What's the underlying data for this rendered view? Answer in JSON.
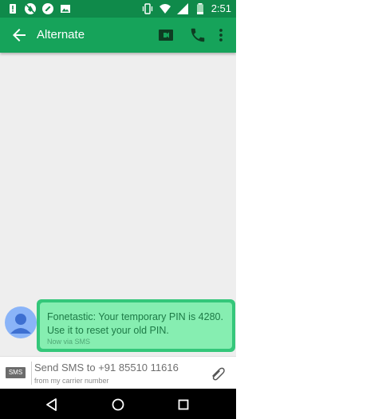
{
  "status_bar": {
    "time": "2:51",
    "left_icons": [
      "alert-icon",
      "no-disturb-icon",
      "edit-icon",
      "image-icon"
    ],
    "right_icons": [
      "vibrate-icon",
      "wifi-icon",
      "signal-icon",
      "battery-icon"
    ]
  },
  "app_bar": {
    "title": "Alternate",
    "icons": [
      "back-arrow-icon",
      "video-call-icon",
      "phone-icon",
      "more-vert-icon"
    ]
  },
  "conversation": {
    "messages": [
      {
        "text": "Fonetastic: Your temporary PIN is 4280. Use it to reset your old PIN.",
        "meta": "Now via SMS"
      }
    ]
  },
  "compose": {
    "badge": "SMS",
    "placeholder": "Send SMS to +91 85510 11616",
    "subtext": "from my carrier number",
    "attach_icon": "paperclip-icon"
  },
  "nav_bar": {
    "icons": [
      "back-triangle-icon",
      "home-circle-icon",
      "recents-square-icon"
    ]
  },
  "colors": {
    "status_bar": "#0f8a4a",
    "app_bar": "#16a35a",
    "bubble_outer": "#34c77a",
    "bubble_inner": "#86eeb1",
    "message_text": "#1d7a46",
    "avatar": "#8ab4f8"
  }
}
